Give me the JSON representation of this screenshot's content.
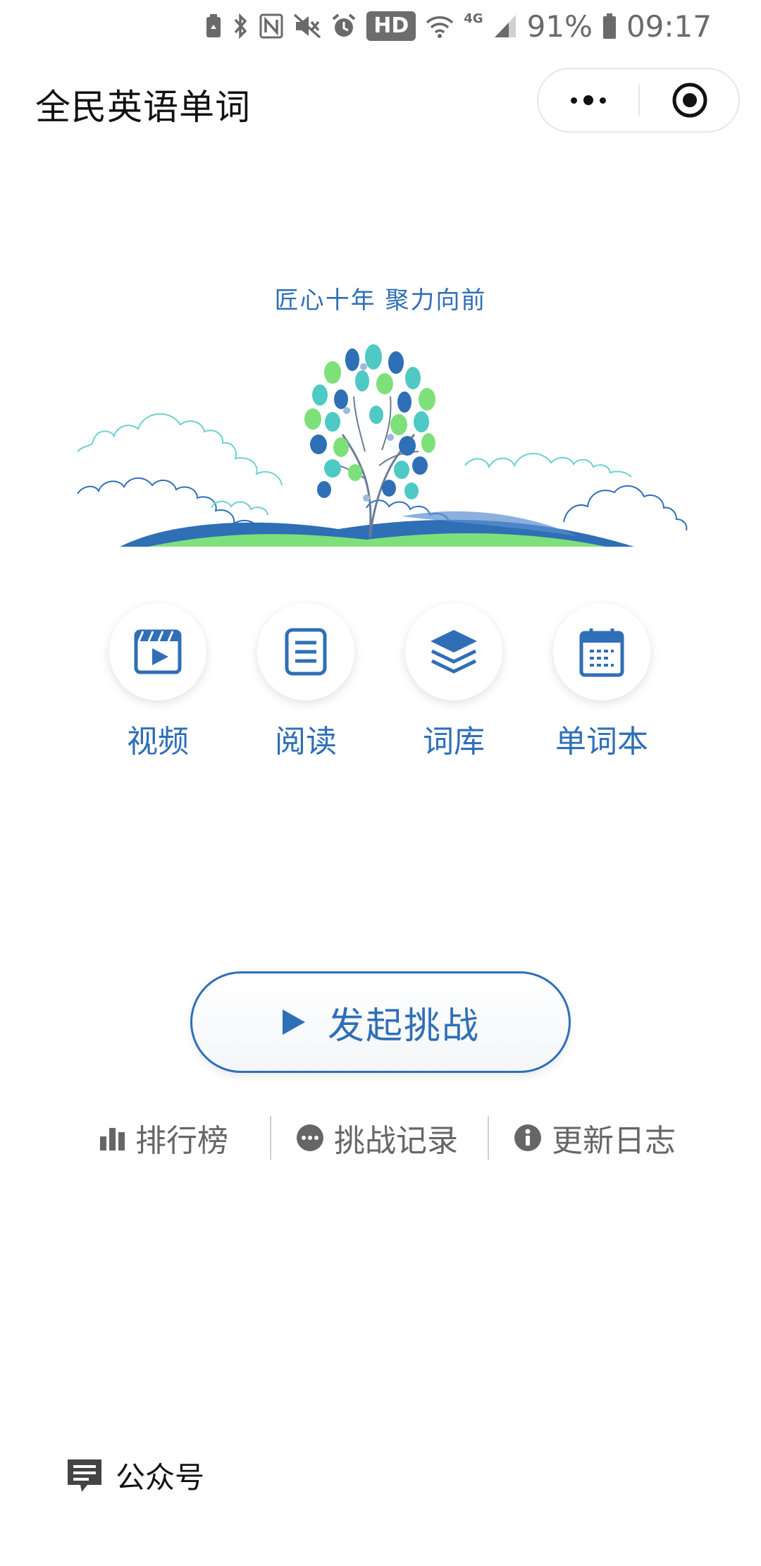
{
  "status_bar": {
    "network_label": "4G",
    "hd_label": "HD",
    "battery": "91%",
    "time": "09:17"
  },
  "header": {
    "title": "全民英语单词"
  },
  "hero": {
    "slogan": "匠心十年 聚力向前"
  },
  "features": [
    {
      "label": "视频",
      "icon": "video-clapper-icon"
    },
    {
      "label": "阅读",
      "icon": "document-icon"
    },
    {
      "label": "词库",
      "icon": "layers-icon"
    },
    {
      "label": "单词本",
      "icon": "notebook-calendar-icon"
    }
  ],
  "challenge": {
    "label": "发起挑战",
    "icon": "play-icon"
  },
  "links": [
    {
      "label": "排行榜",
      "icon": "bar-chart-icon"
    },
    {
      "label": "挑战记录",
      "icon": "chat-dots-icon"
    },
    {
      "label": "更新日志",
      "icon": "info-icon"
    }
  ],
  "footer": {
    "official_account": "公众号",
    "icon": "message-icon"
  },
  "colors": {
    "accent": "#2f6fb6",
    "muted_text": "#666666",
    "green": "#7ee07a",
    "teal": "#4fc9c4"
  }
}
